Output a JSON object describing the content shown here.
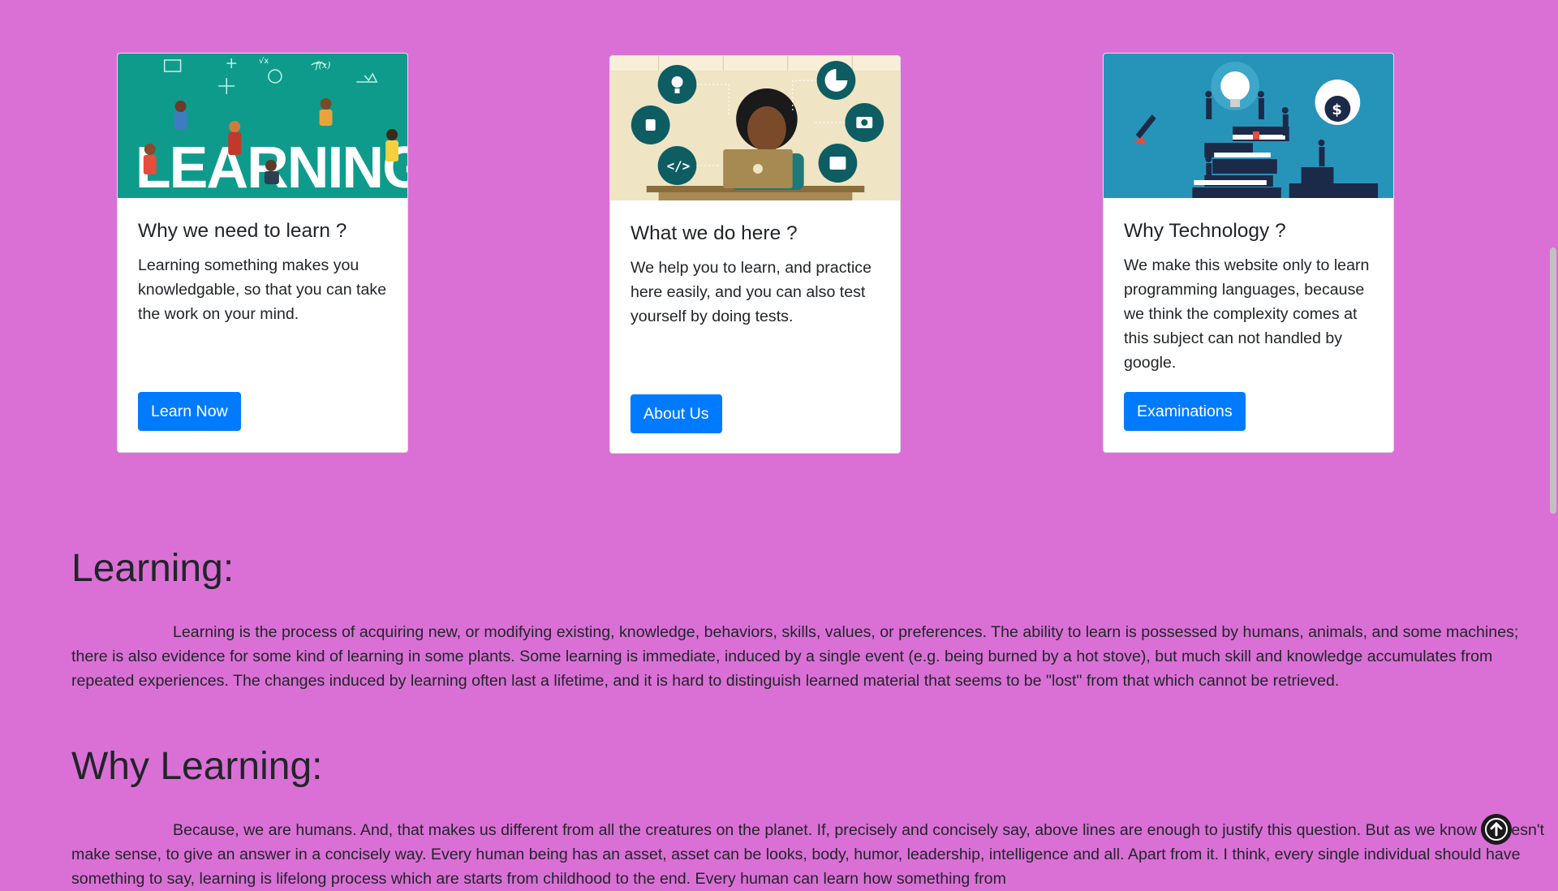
{
  "cards": [
    {
      "image_alt": "LEARNING",
      "image_word": "LEARNING",
      "title": "Why we need to learn ?",
      "text": "Learning something makes you knowledgable, so that you can take the work on your mind.",
      "button": "Learn Now"
    },
    {
      "image_alt": "person at laptop with icons",
      "title": "What we do here ?",
      "text": "We help you to learn, and practice here easily, and you can also test yourself by doing tests.",
      "button": "About Us"
    },
    {
      "image_alt": "business people on books with lightbulb",
      "title": "Why Technology ?",
      "text": "We make this website only to learn programming languages, because we think the complexity comes at this subject can not handled by google.",
      "button": "Examinations"
    }
  ],
  "sections": [
    {
      "heading": "Learning:",
      "text": "Learning is the process of acquiring new, or modifying existing, knowledge, behaviors, skills, values, or preferences. The ability to learn is possessed by humans, animals, and some machines; there is also evidence for some kind of learning in some plants. Some learning is immediate, induced by a single event (e.g. being burned by a hot stove), but much skill and knowledge accumulates from repeated experiences. The changes induced by learning often last a lifetime, and it is hard to distinguish learned material that seems to be \"lost\" from that which cannot be retrieved."
    },
    {
      "heading": "Why Learning:",
      "text": "Because, we are humans. And, that makes us different from all the creatures on the planet. If, precisely and concisely say, above lines are enough to justify this question. But as we know it doesn't make sense, to give an answer in a concisely way. Every human being has an asset, asset can be looks, body, humor, leadership, intelligence and all. Apart from it. I think, every single individual should have something to say, learning is lifelong process which are starts from childhood to the end. Every human can learn how something from"
    }
  ],
  "colors": {
    "page_bg": "#da70d6",
    "button": "#007bff",
    "card1_img_bg": "#0e9b8c",
    "card2_img_bg": "#efe4c4",
    "card3_img_bg": "#2694b8"
  },
  "icons": {
    "back_to_top": "arrow-up-circle-icon"
  }
}
